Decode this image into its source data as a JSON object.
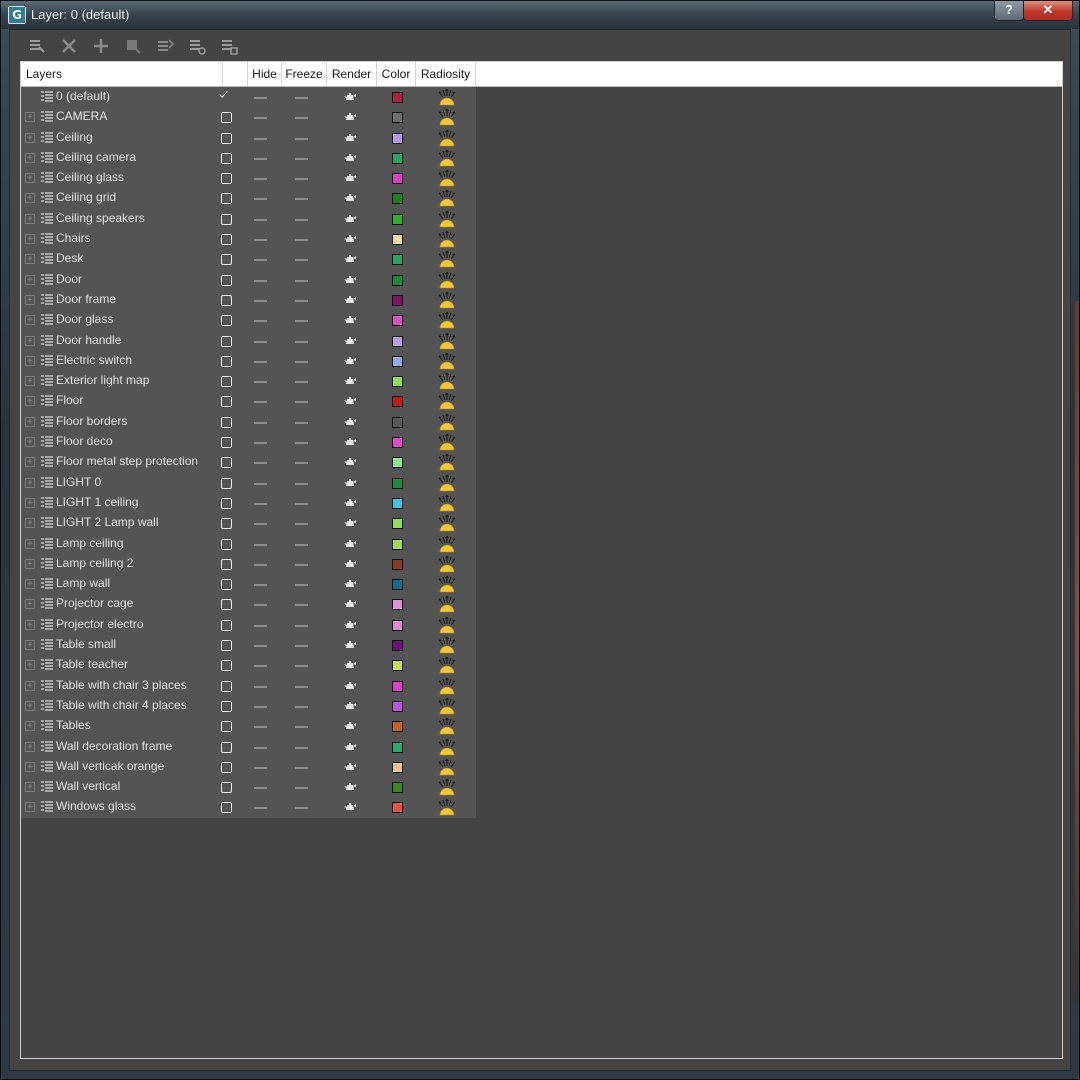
{
  "window": {
    "title": "Layer: 0 (default)",
    "help_label": "?",
    "close_label": "✕"
  },
  "toolbar": {
    "tools": [
      {
        "icon": "create-layer-icon"
      },
      {
        "icon": "delete-layer-icon"
      },
      {
        "icon": "add-selection-icon"
      },
      {
        "icon": "select-objects-icon"
      },
      {
        "icon": "highlight-layer-icon"
      },
      {
        "icon": "hide-all-icon"
      },
      {
        "icon": "freeze-all-icon"
      }
    ]
  },
  "table": {
    "columns": [
      {
        "label": "Layers"
      },
      {
        "label": ""
      },
      {
        "label": "Hide"
      },
      {
        "label": "Freeze"
      },
      {
        "label": "Render"
      },
      {
        "label": "Color"
      },
      {
        "label": "Radiosity"
      }
    ],
    "rows": [
      {
        "name": "0 (default)",
        "active": true,
        "color": "#b01e48"
      },
      {
        "name": "CAMERA",
        "active": false,
        "color": "#6c6c6c"
      },
      {
        "name": "Ceiling",
        "active": false,
        "color": "#b49ae6"
      },
      {
        "name": "Ceiling camera",
        "active": false,
        "color": "#22a86a"
      },
      {
        "name": "Ceiling glass",
        "active": false,
        "color": "#e03cc8"
      },
      {
        "name": "Ceiling grid",
        "active": false,
        "color": "#1f7e1f"
      },
      {
        "name": "Ceiling speakers",
        "active": false,
        "color": "#28b428"
      },
      {
        "name": "Chairs",
        "active": false,
        "color": "#e6e6a0"
      },
      {
        "name": "Desk",
        "active": false,
        "color": "#20a860"
      },
      {
        "name": "Door",
        "active": false,
        "color": "#168c40"
      },
      {
        "name": "Door frame",
        "active": false,
        "color": "#7c1464"
      },
      {
        "name": "Door glass",
        "active": false,
        "color": "#e050c0"
      },
      {
        "name": "Door handle",
        "active": false,
        "color": "#b8a0e6"
      },
      {
        "name": "Electric switch",
        "active": false,
        "color": "#98a8e8"
      },
      {
        "name": "Exterior light map",
        "active": false,
        "color": "#8ce050"
      },
      {
        "name": "Floor",
        "active": false,
        "color": "#c41818"
      },
      {
        "name": "Floor borders",
        "active": false,
        "color": "#5a5a5a"
      },
      {
        "name": "Floor deco",
        "active": false,
        "color": "#e04cc4"
      },
      {
        "name": "Floor metal step protection",
        "active": false,
        "color": "#90e890"
      },
      {
        "name": "LIGHT 0",
        "active": false,
        "color": "#1a8a3c"
      },
      {
        "name": "LIGHT 1 ceiling",
        "active": false,
        "color": "#3cc8e6"
      },
      {
        "name": "LIGHT 2 Lamp wall",
        "active": false,
        "color": "#90e050"
      },
      {
        "name": "Lamp ceiling",
        "active": false,
        "color": "#a8d850"
      },
      {
        "name": "Lamp ceiling 2",
        "active": false,
        "color": "#8a3c14"
      },
      {
        "name": "Lamp wall",
        "active": false,
        "color": "#146c8a"
      },
      {
        "name": "Projector cage",
        "active": false,
        "color": "#e090d8"
      },
      {
        "name": "Projector electro",
        "active": false,
        "color": "#e08ad0"
      },
      {
        "name": "Table small",
        "active": false,
        "color": "#6a1478"
      },
      {
        "name": "Table teacher",
        "active": false,
        "color": "#c8e050"
      },
      {
        "name": "Table with chair 3 places",
        "active": false,
        "color": "#e040c8"
      },
      {
        "name": "Table with chair 4 places",
        "active": false,
        "color": "#c050e0"
      },
      {
        "name": "Tables",
        "active": false,
        "color": "#c8641c"
      },
      {
        "name": "Wall decoration frame",
        "active": false,
        "color": "#22b070"
      },
      {
        "name": "Wall verticak orange",
        "active": false,
        "color": "#e8c890"
      },
      {
        "name": "Wall vertical",
        "active": false,
        "color": "#3c8a1e"
      },
      {
        "name": "Windows glass",
        "active": false,
        "color": "#e85050"
      }
    ]
  }
}
